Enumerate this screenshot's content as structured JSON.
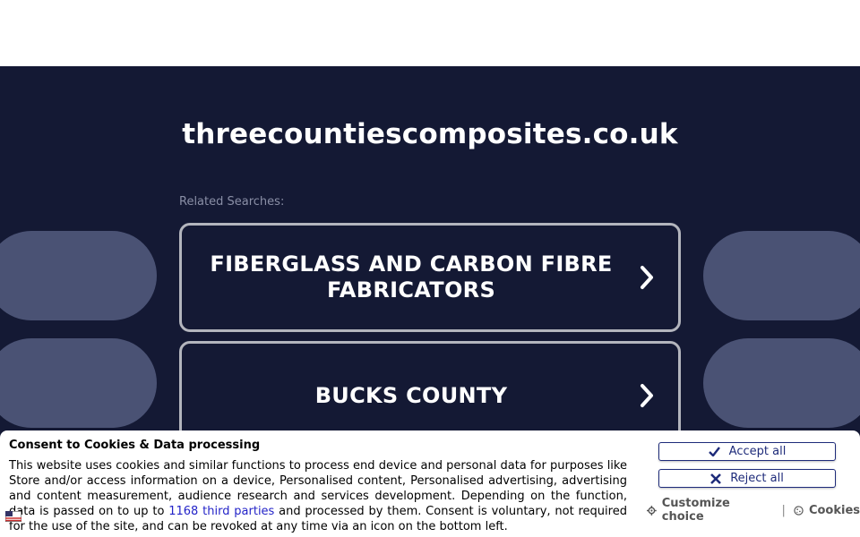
{
  "page": {
    "domain": "threecountiescomposites.co.uk",
    "related_label": "Related Searches:",
    "links": [
      {
        "label": "FIBERGLASS AND CARBON FIBRE FABRICATORS",
        "icon": "chevron-right-icon"
      },
      {
        "label": "BUCKS COUNTY",
        "icon": "chevron-right-icon"
      }
    ]
  },
  "consent": {
    "title": "Consent to Cookies & Data processing",
    "text_before": "This website uses cookies and similar functions to process end device and personal data for purposes like Store and/or access information on a device, Personalised content, Personalised advertising, advertising and content measurement, audience research and services development. Depending on the function, data is passed on to up to ",
    "third_parties_link": "1168 third parties",
    "text_after": " and processed by them. Consent is voluntary, not required for the use of the site, and can be revoked at any time via an icon on the bottom left.",
    "accept_label": "Accept all",
    "reject_label": "Reject all",
    "customize_label": "Customize choice",
    "separator": "|",
    "cookies_label": "Cookies"
  },
  "colors": {
    "background": "#141934",
    "pill": "#4a5274",
    "link_border": "#b3b5bd",
    "button_accent": "#1e2b7a"
  }
}
